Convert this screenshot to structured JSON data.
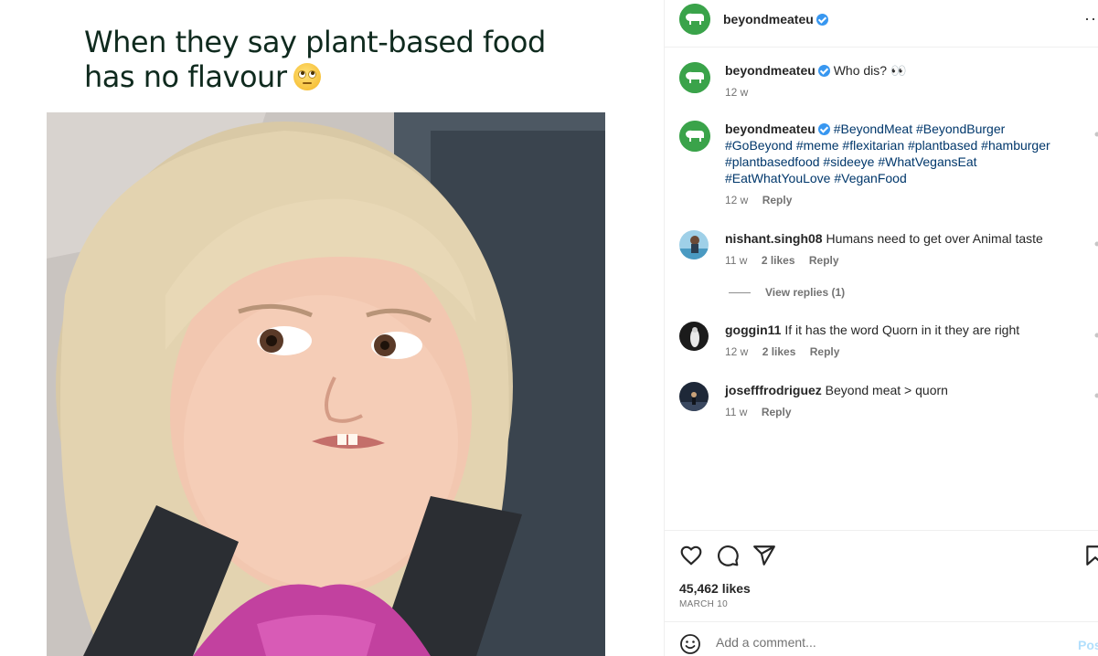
{
  "meme": {
    "caption_line1": "When they say plant-based food",
    "caption_line2": "has no flavour",
    "caption_emoji": "eye-roll-emoji"
  },
  "header": {
    "username": "beyondmeateu",
    "verified": true,
    "more_label": "···"
  },
  "comments": [
    {
      "username": "beyondmeateu",
      "verified": true,
      "text": "Who dis? 👀",
      "time": "12 w",
      "likes": "",
      "reply": ""
    },
    {
      "username": "beyondmeateu",
      "verified": true,
      "hashtags": "#BeyondMeat #BeyondBurger #GoBeyond #meme #flexitarian #plantbased #hamburger #plantbasedfood #sideeye #WhatVegansEat #EatWhatYouLove #VeganFood",
      "time": "12 w",
      "reply": "Reply"
    },
    {
      "username": "nishant.singh08",
      "text": "Humans need to get over Animal taste",
      "time": "11 w",
      "likes": "2 likes",
      "reply": "Reply",
      "view_replies": "View replies (1)"
    },
    {
      "username": "goggin11",
      "text": "If it has the word Quorn in it they are right",
      "time": "12 w",
      "likes": "2 likes",
      "reply": "Reply"
    },
    {
      "username": "josefffrodriguez",
      "text": "Beyond meat > quorn",
      "time": "11 w",
      "reply": "Reply"
    }
  ],
  "actions": {
    "like_icon": "heart-icon",
    "comment_icon": "comment-bubble-icon",
    "share_icon": "paper-plane-icon",
    "save_icon": "bookmark-icon",
    "likes_count": "45,462 likes",
    "date": "MARCH 10"
  },
  "add_comment": {
    "placeholder": "Add a comment...",
    "post_label": "Post",
    "emoji_icon": "smiley-icon"
  },
  "colors": {
    "brand_green": "#3aa34a",
    "link_blue": "#00376b",
    "verified_blue": "#3897f0",
    "caption_green": "#0f2a1e"
  }
}
